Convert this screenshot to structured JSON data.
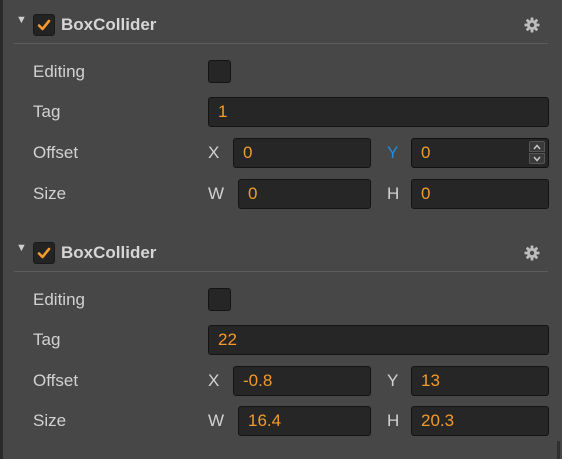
{
  "components": [
    {
      "title": "BoxCollider",
      "enabled": true,
      "editing_label": "Editing",
      "tag_label": "Tag",
      "tag_value": "1",
      "offset_label": "Offset",
      "offset_x_label": "X",
      "offset_x": "0",
      "offset_y_label": "Y",
      "offset_y": "0",
      "size_label": "Size",
      "size_w_label": "W",
      "size_w": "0",
      "size_h_label": "H",
      "size_h": "0"
    },
    {
      "title": "BoxCollider",
      "enabled": true,
      "editing_label": "Editing",
      "tag_label": "Tag",
      "tag_value": "22",
      "offset_label": "Offset",
      "offset_x_label": "X",
      "offset_x": "-0.8",
      "offset_y_label": "Y",
      "offset_y": "13",
      "size_label": "Size",
      "size_w_label": "W",
      "size_w": "16.4",
      "size_h_label": "H",
      "size_h": "20.3"
    }
  ],
  "colors": {
    "panel_bg": "#474747",
    "value_text": "#f49a2b",
    "active_axis": "#1e8fe0",
    "checkmark": "#f49a2b"
  },
  "icons": {
    "fold": "triangle-down-icon",
    "enable": "checkmark-icon",
    "settings": "gear-icon",
    "stepper": "chevron-up-down-icon"
  }
}
